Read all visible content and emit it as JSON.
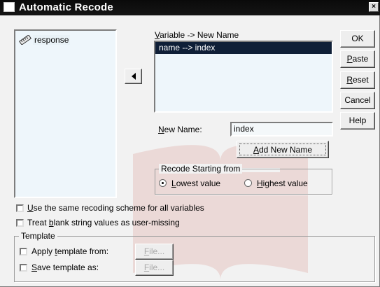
{
  "window": {
    "title": "Automatic Recode",
    "close_glyph": "×"
  },
  "source_vars": {
    "items": [
      {
        "label": "response",
        "icon": "scale-ruler-icon"
      }
    ]
  },
  "mapping": {
    "header": "Variable -> New Name",
    "header_hotkey": "V",
    "header_rest": "ariable -> New Name",
    "items": [
      "name --> index"
    ]
  },
  "new_name": {
    "label_hotkey": "N",
    "label_rest": "ew Name:",
    "value": "index"
  },
  "add_button": {
    "hotkey": "A",
    "rest": "dd New Name"
  },
  "recode_group": {
    "legend": "Recode Starting from",
    "lowest": {
      "hotkey": "L",
      "rest": "owest value",
      "selected": true
    },
    "highest": {
      "hotkey": "H",
      "rest": "ighest value",
      "selected": false
    }
  },
  "buttons": {
    "ok": "OK",
    "paste_hotkey": "P",
    "paste_rest": "aste",
    "reset_hotkey": "R",
    "reset_rest": "eset",
    "cancel": "Cancel",
    "help": "Help"
  },
  "options": {
    "same_scheme": {
      "hotkey": "U",
      "rest": "se the same recoding scheme for all variables",
      "checked": false
    },
    "blank_strings": {
      "pre": "Treat ",
      "hotkey": "b",
      "rest": "lank string values as user-missing",
      "checked": false
    }
  },
  "template_group": {
    "legend": "Template",
    "apply": {
      "pre": "Apply ",
      "hotkey": "t",
      "rest": "emplate from:",
      "checked": false
    },
    "save": {
      "hotkey": "S",
      "rest": "ave template as:",
      "checked": false
    },
    "file_button_hotkey": "F",
    "file_button_rest": "ile..."
  }
}
